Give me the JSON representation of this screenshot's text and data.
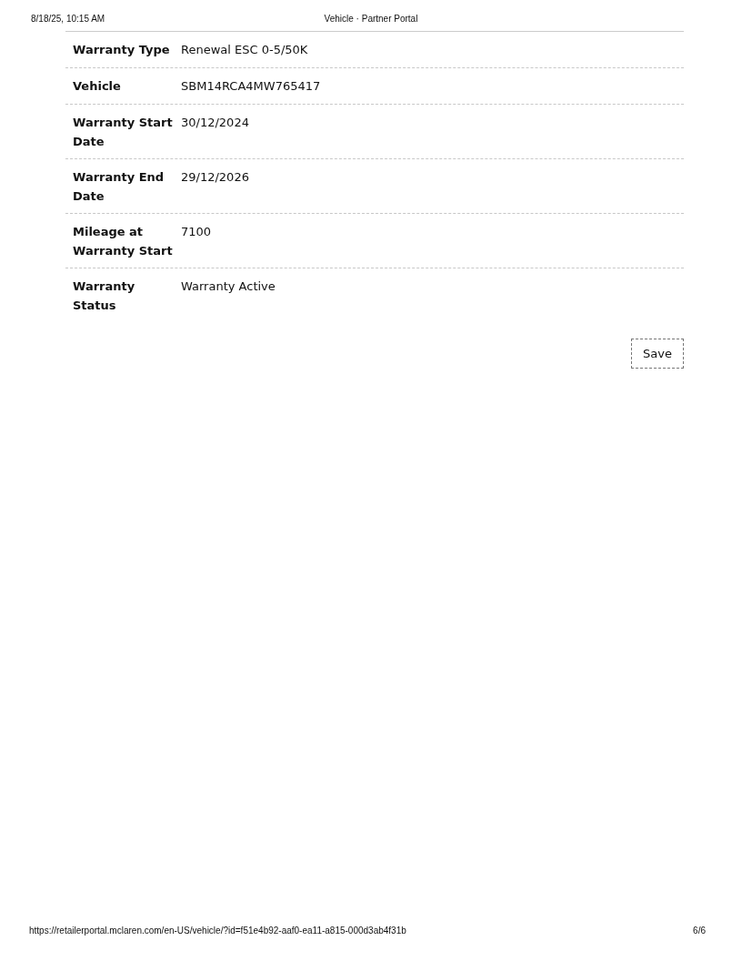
{
  "print_header": {
    "date": "8/18/25, 10:15 AM",
    "title": "Vehicle · Partner Portal"
  },
  "fields": [
    {
      "label": "Warranty Type",
      "value": "Renewal ESC 0-5/50K"
    },
    {
      "label": "Vehicle",
      "value": "SBM14RCA4MW765417"
    },
    {
      "label": "Warranty Start Date",
      "value": "30/12/2024"
    },
    {
      "label": "Warranty End Date",
      "value": "29/12/2026"
    },
    {
      "label": "Mileage at Warranty Start",
      "value": "7100"
    },
    {
      "label": "Warranty Status",
      "value": "Warranty Active"
    }
  ],
  "save_button": "Save",
  "print_footer": {
    "url": "https://retailerportal.mclaren.com/en-US/vehicle/?id=f51e4b92-aaf0-ea11-a815-000d3ab4f31b",
    "page": "6/6"
  }
}
